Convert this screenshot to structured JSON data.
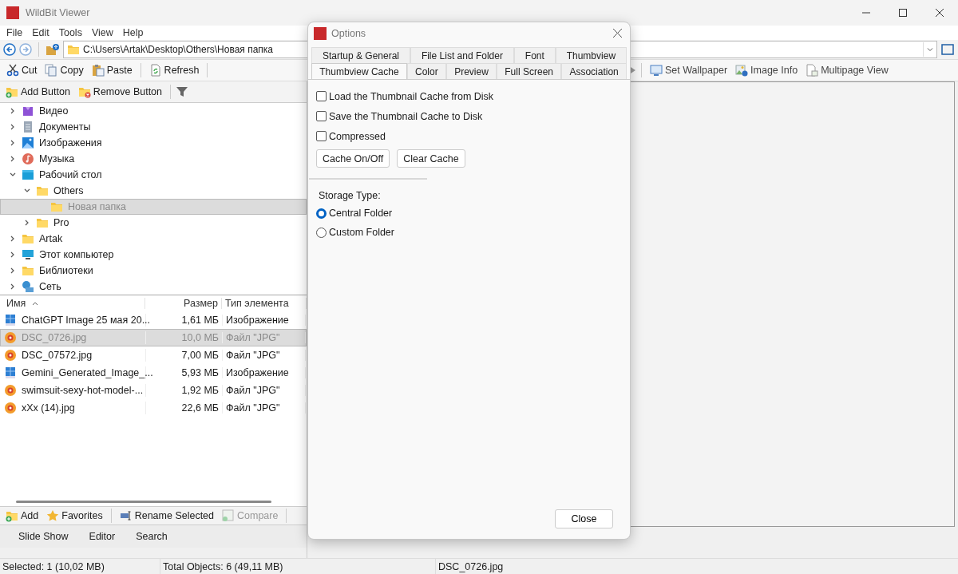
{
  "window": {
    "title": "WildBit Viewer"
  },
  "menu": [
    "File",
    "Edit",
    "Tools",
    "View",
    "Help"
  ],
  "address": {
    "value": "C:\\Users\\Artak\\Desktop\\Others\\Новая папка"
  },
  "toolbar": {
    "left": [
      {
        "label": "Cut",
        "kind": "cut"
      },
      {
        "label": "Copy",
        "kind": "copy"
      },
      {
        "label": "Paste",
        "kind": "paste"
      },
      {
        "label": "Refresh",
        "kind": "refresh"
      }
    ],
    "right": [
      {
        "label": "Set Wallpaper",
        "kind": "wallpaper"
      },
      {
        "label": "Image Info",
        "kind": "info"
      },
      {
        "label": "Multipage View",
        "kind": "multipage"
      }
    ]
  },
  "folder_toolbar": [
    {
      "label": "Add Button",
      "kind": "add"
    },
    {
      "label": "Remove Button",
      "kind": "remove"
    }
  ],
  "tree": [
    {
      "label": "Видео",
      "kind": "video",
      "expanded": false,
      "selected": false
    },
    {
      "label": "Документы",
      "kind": "documents",
      "expanded": false,
      "selected": false
    },
    {
      "label": "Изображения",
      "kind": "pictures",
      "expanded": false,
      "selected": false
    },
    {
      "label": "Музыка",
      "kind": "music",
      "expanded": false,
      "selected": false
    },
    {
      "label": "Рабочий стол",
      "kind": "desktop",
      "expanded": true,
      "selected": false,
      "children": [
        {
          "label": "Others",
          "kind": "folder",
          "expanded": true,
          "selected": false,
          "children": [
            {
              "label": "Новая папка",
              "kind": "folder",
              "selected": true
            }
          ]
        },
        {
          "label": "Pro",
          "kind": "folder",
          "expanded": false,
          "selected": false
        }
      ]
    },
    {
      "label": "Artak",
      "kind": "folder",
      "expanded": false,
      "selected": false
    },
    {
      "label": "Этот компьютер",
      "kind": "computer",
      "expanded": false,
      "selected": false
    },
    {
      "label": "Библиотеки",
      "kind": "folder",
      "expanded": false,
      "selected": false
    },
    {
      "label": "Сеть",
      "kind": "network",
      "expanded": false,
      "selected": false
    }
  ],
  "file_list": {
    "columns": [
      "Имя",
      "Размер",
      "Тип элемента"
    ],
    "rows": [
      {
        "name": "ChatGPT Image 25 мая 20...",
        "size": "1,61 МБ",
        "type": "Изображение",
        "kind": "png",
        "selected": false
      },
      {
        "name": "DSC_0726.jpg",
        "size": "10,0 МБ",
        "type": "Файл \"JPG\"",
        "kind": "jpg",
        "selected": true
      },
      {
        "name": "DSC_07572.jpg",
        "size": "7,00 МБ",
        "type": "Файл \"JPG\"",
        "kind": "jpg",
        "selected": false
      },
      {
        "name": "Gemini_Generated_Image_...",
        "size": "5,93 МБ",
        "type": "Изображение",
        "kind": "png",
        "selected": false
      },
      {
        "name": "swimsuit-sexy-hot-model-...",
        "size": "1,92 МБ",
        "type": "Файл \"JPG\"",
        "kind": "jpg",
        "selected": false
      },
      {
        "name": "xXx (14).jpg",
        "size": "22,6 МБ",
        "type": "Файл \"JPG\"",
        "kind": "jpg",
        "selected": false
      }
    ]
  },
  "bottom_toolbar": [
    {
      "label": "Add",
      "kind": "add",
      "disabled": false
    },
    {
      "label": "Favorites",
      "kind": "star",
      "disabled": false
    },
    {
      "label": "Rename Selected",
      "kind": "rename",
      "disabled": false
    },
    {
      "label": "Compare",
      "kind": "compare",
      "disabled": true
    }
  ],
  "bottom_tabs": [
    "Slide Show",
    "Editor",
    "Search"
  ],
  "status_bar": [
    "Selected: 1 (10,02 MB)",
    "Total Objects: 6 (49,11 MB)",
    "DSC_0726.jpg"
  ],
  "dialog": {
    "title": "Options",
    "tab_rows": [
      [
        {
          "label": "Startup & General",
          "selected": false
        },
        {
          "label": "File List and Folder",
          "selected": false
        },
        {
          "label": "Font",
          "selected": false
        },
        {
          "label": "Thumbview",
          "selected": false
        }
      ],
      [
        {
          "label": "Thumbview Cache",
          "selected": true
        },
        {
          "label": "Color",
          "selected": false
        },
        {
          "label": "Preview",
          "selected": false
        },
        {
          "label": "Full Screen",
          "selected": false
        },
        {
          "label": "Association",
          "selected": false
        }
      ]
    ],
    "checkboxes": [
      {
        "label": "Load the Thumbnail Cache from Disk",
        "checked": false
      },
      {
        "label": "Save the Thumbnail Cache to Disk",
        "checked": false
      },
      {
        "label": "Compressed",
        "checked": false
      }
    ],
    "buttons": [
      "Cache On/Off",
      "Clear Cache"
    ],
    "storage_label": "Storage Type:",
    "radios": [
      {
        "label": "Central Folder",
        "selected": true
      },
      {
        "label": "Custom Folder",
        "selected": false
      }
    ],
    "close_button": "Close"
  }
}
